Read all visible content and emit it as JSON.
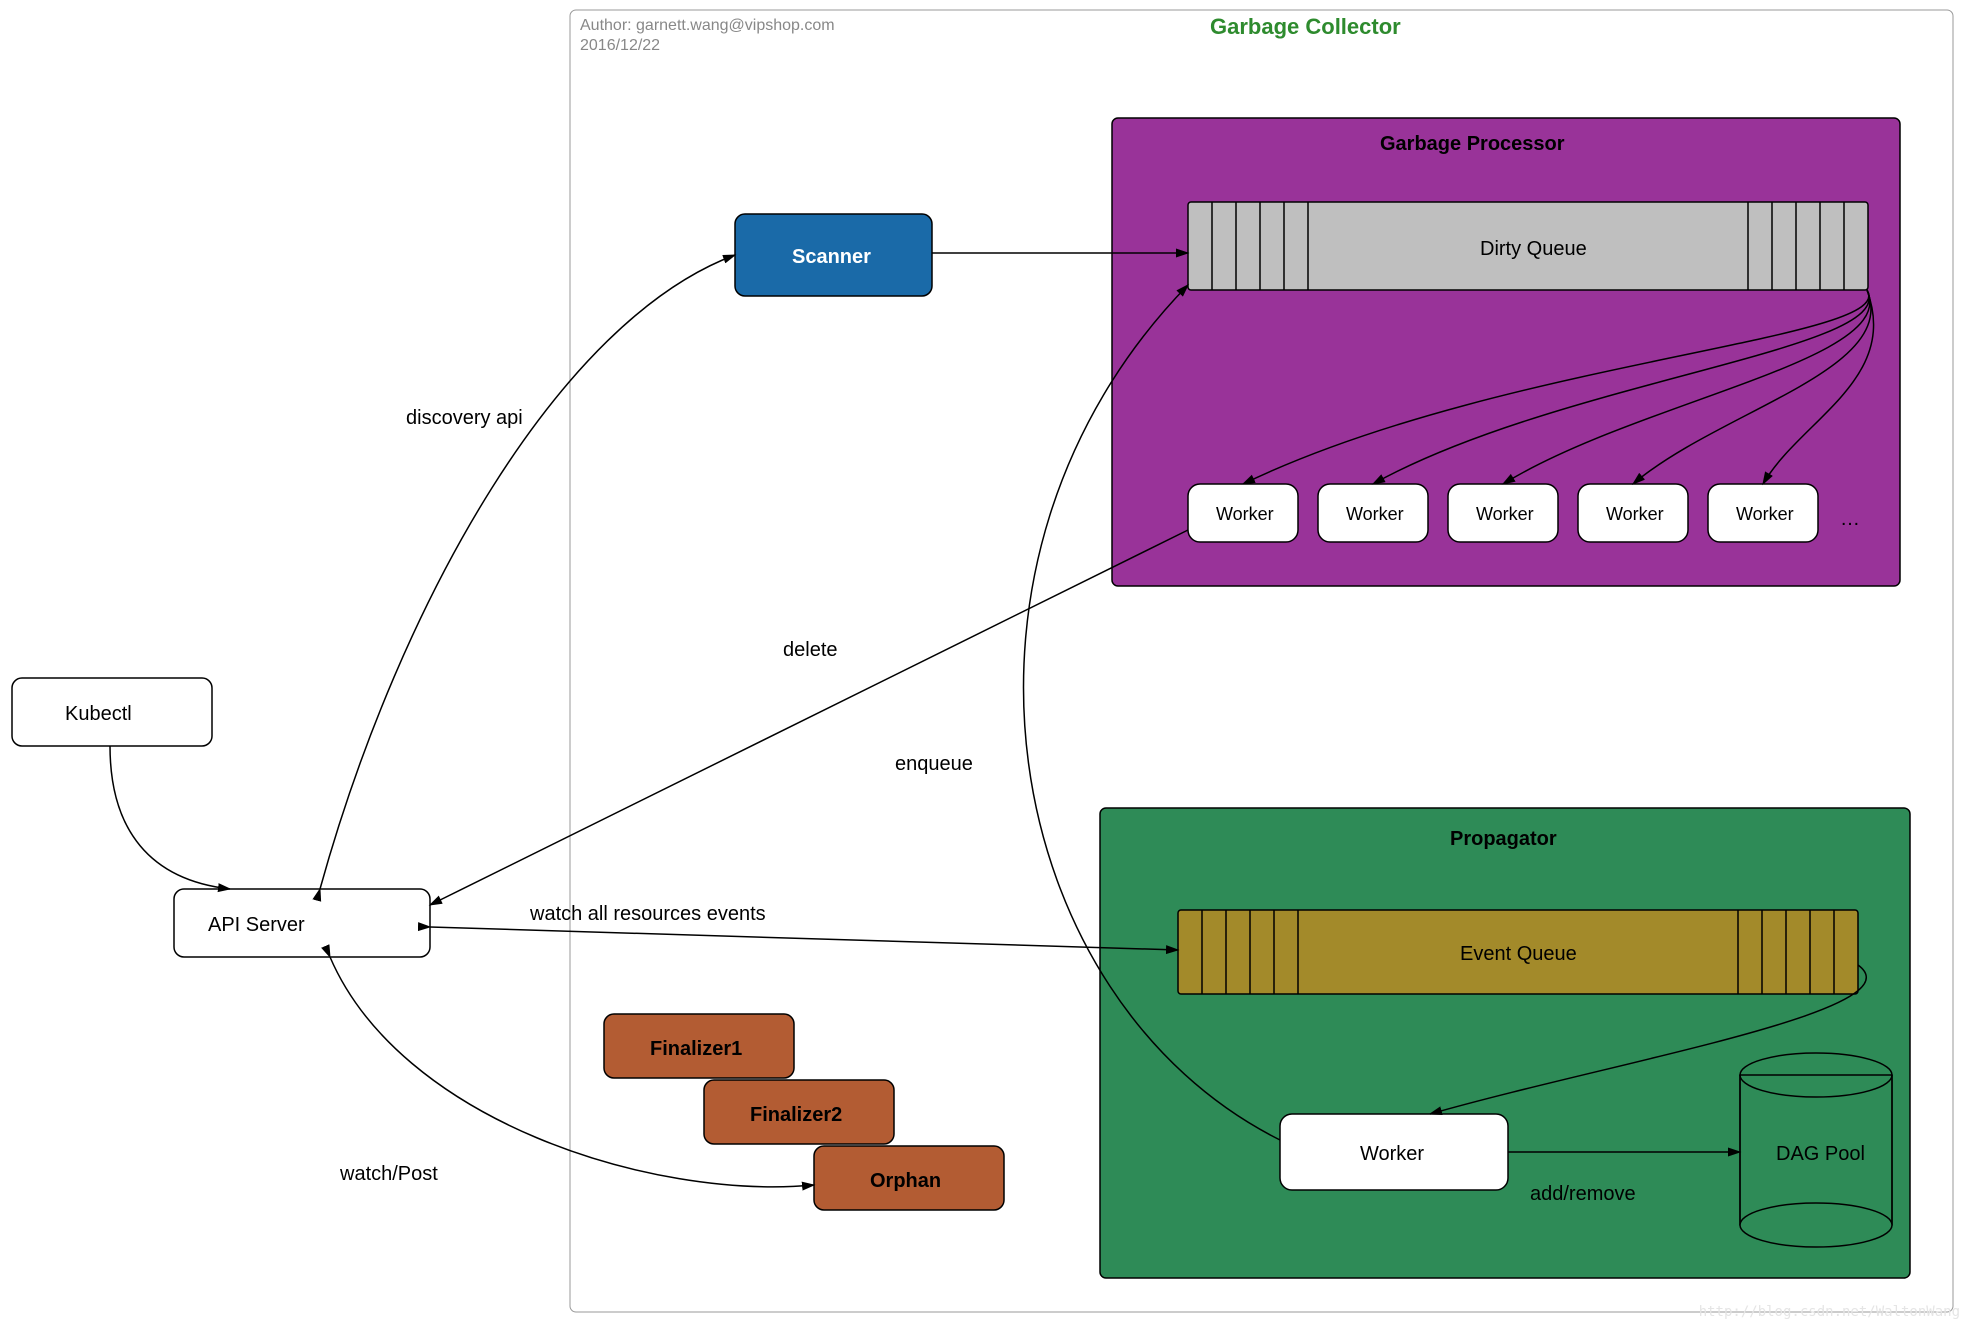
{
  "meta": {
    "author_line": "Author: garnett.wang@vipshop.com",
    "date_line": "2016/12/22",
    "watermark": "http://blog.csdn.net/WaltonWang"
  },
  "title": "Garbage Collector",
  "nodes": {
    "kubectl": "Kubectl",
    "api_server": "API Server",
    "scanner": "Scanner",
    "garbage_processor_title": "Garbage Processor",
    "dirty_queue": "Dirty Queue",
    "worker": "Worker",
    "ellipsis": "…",
    "propagator_title": "Propagator",
    "event_queue": "Event Queue",
    "propagator_worker": "Worker",
    "dag_pool": "DAG Pool",
    "finalizer1": "Finalizer1",
    "finalizer2": "Finalizer2",
    "orphan": "Orphan"
  },
  "edges": {
    "discovery_api": "discovery api",
    "delete": "delete",
    "enqueue": "enqueue",
    "watch_all": "watch all resources events",
    "watch_post": "watch/Post",
    "add_remove": "add/remove"
  }
}
